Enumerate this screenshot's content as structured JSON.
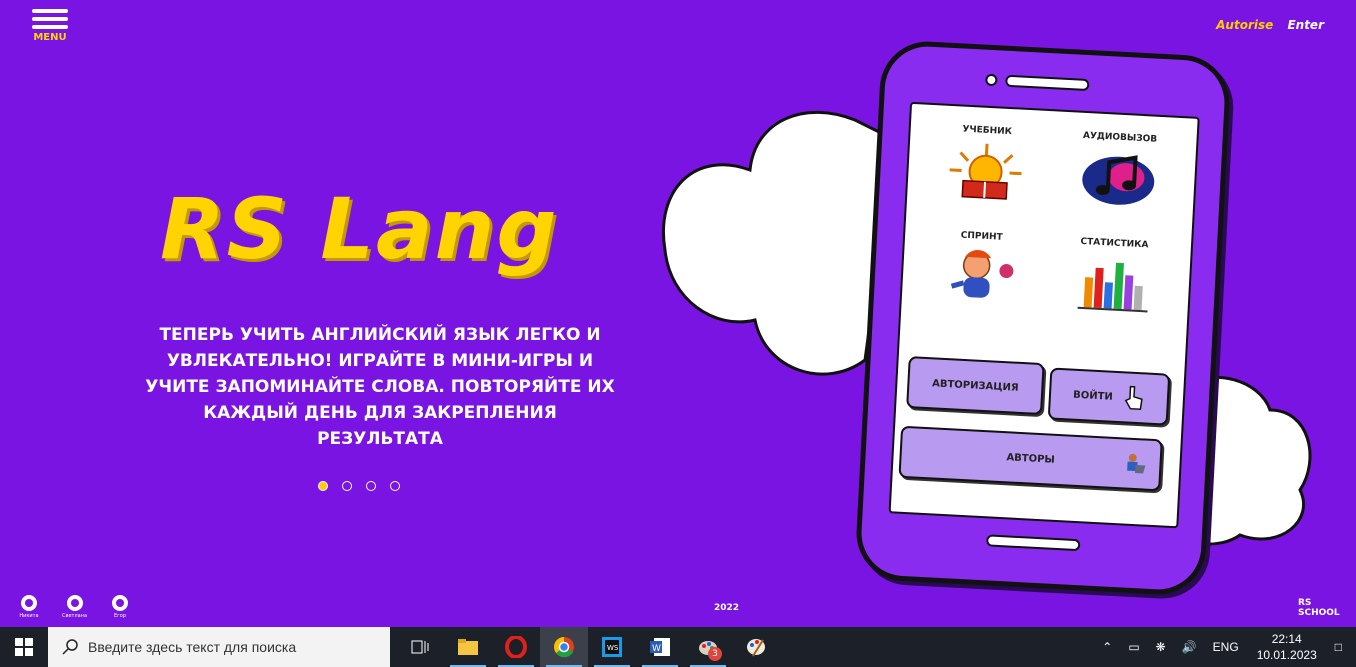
{
  "header": {
    "menu_label": "MENU",
    "authorise_label": "Autorise",
    "enter_label": "Enter"
  },
  "hero": {
    "logo": "RS Lang",
    "tagline": "Теперь учить английский язык легко и увлекательно! Играйте в мини-игры и учите запоминайте слова. Повторяйте их каждый день для закрепления результата",
    "slides_total": 4,
    "active_slide": 1
  },
  "phone": {
    "apps": [
      {
        "label": "УЧЕБНИК",
        "icon": "sun-book-icon"
      },
      {
        "label": "АУДИОВЫЗОВ",
        "icon": "music-note-icon"
      },
      {
        "label": "СПРИНТ",
        "icon": "running-character-icon"
      },
      {
        "label": "СТАТИСТИКА",
        "icon": "bar-chart-icon"
      }
    ],
    "auth_button": "АВТОРИЗАЦИЯ",
    "login_button": "ВОЙТИ",
    "authors_button": "АВТОРЫ"
  },
  "footer": {
    "authors": [
      {
        "name": "Никита",
        "icon": "github-icon"
      },
      {
        "name": "Светлана",
        "icon": "github-icon"
      },
      {
        "name": "Егор",
        "icon": "github-icon"
      }
    ],
    "year": "2022",
    "school_logo": "RS SCHOOL"
  },
  "taskbar": {
    "search_placeholder": "Введите здесь текст для поиска",
    "apps": [
      {
        "name": "task-view-icon"
      },
      {
        "name": "file-explorer-icon"
      },
      {
        "name": "opera-icon"
      },
      {
        "name": "chrome-icon"
      },
      {
        "name": "webstorm-icon"
      },
      {
        "name": "word-icon"
      },
      {
        "name": "paint-icon",
        "badge": "3"
      },
      {
        "name": "paint-palette-icon"
      }
    ],
    "language": "ENG",
    "time": "22:14",
    "date": "10.01.2023"
  }
}
